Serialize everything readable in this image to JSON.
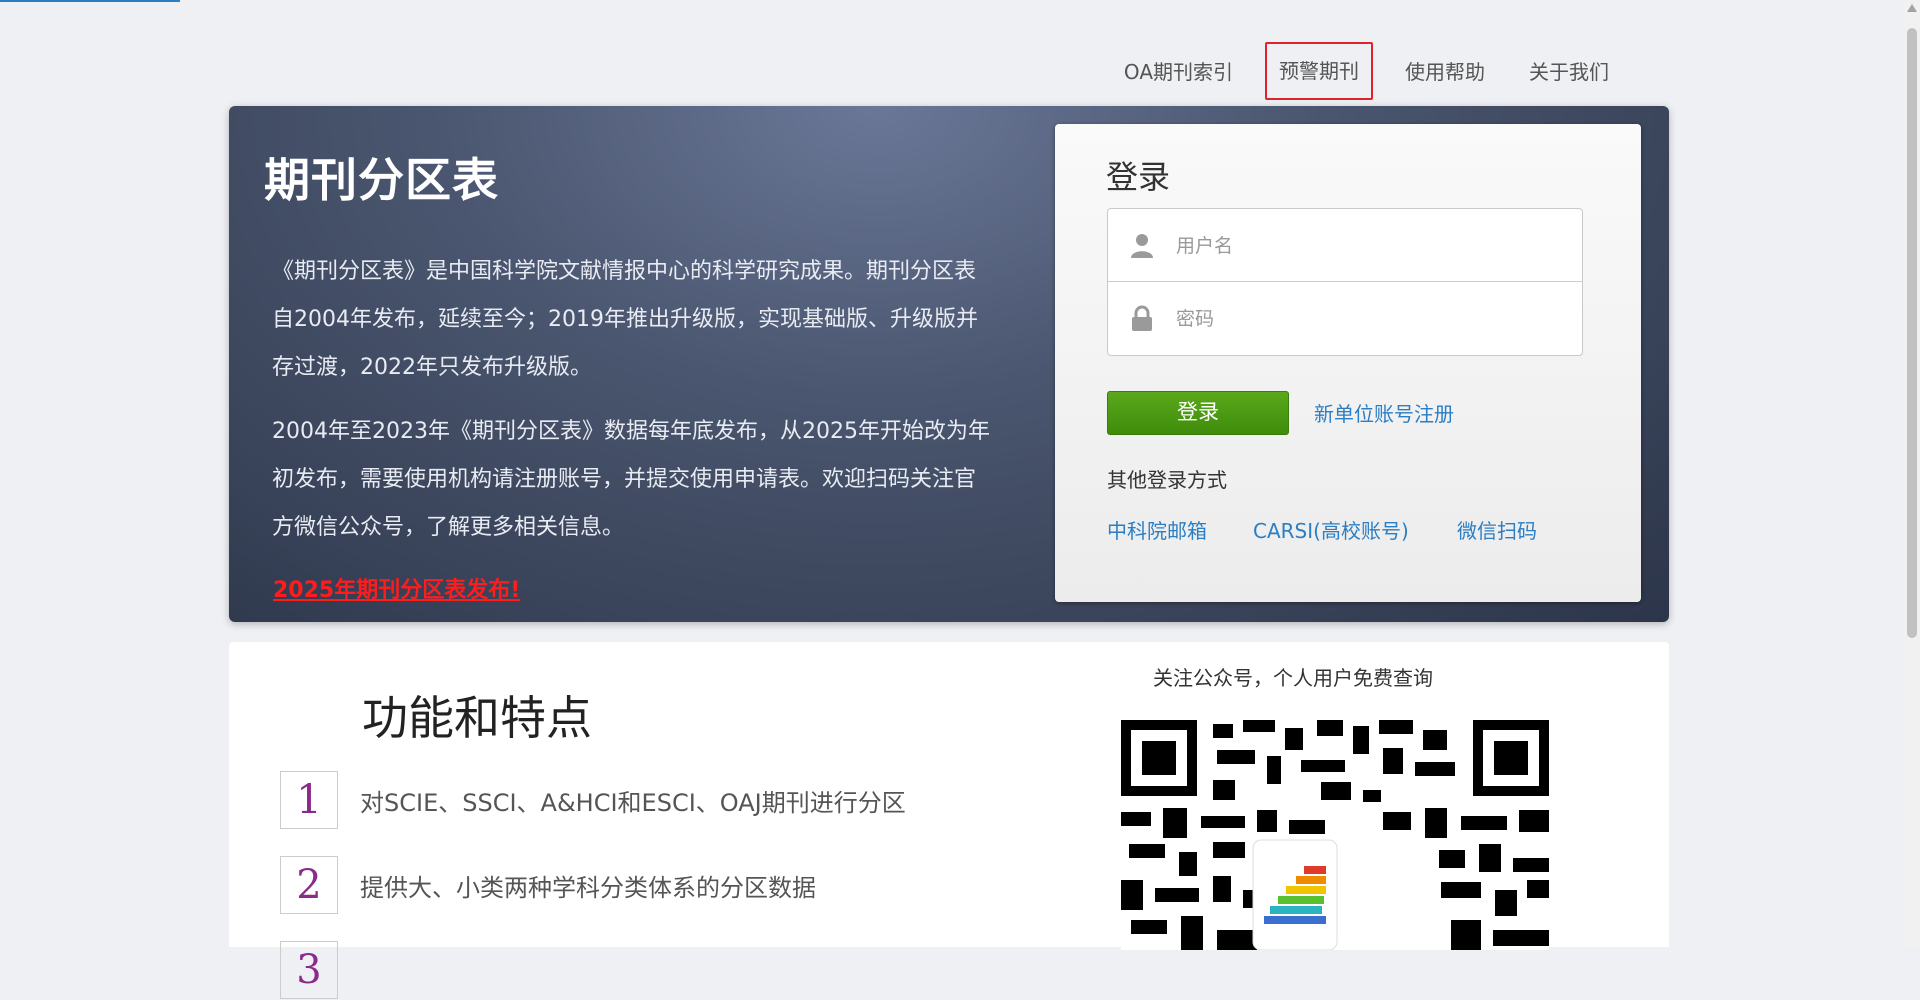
{
  "nav": [
    "OA期刊索引",
    "预警期刊",
    "使用帮助",
    "关于我们"
  ],
  "hero": {
    "title": "期刊分区表",
    "p1": "《期刊分区表》是中国科学院文献情报中心的科学研究成果。期刊分区表自2004年发布，延续至今；2019年推出升级版，实现基础版、升级版并存过渡，2022年只发布升级版。",
    "p2": "2004年至2023年《期刊分区表》数据每年底发布，从2025年开始改为年初发布，需要使用机构请注册账号，并提交使用申请表。欢迎扫码关注官方微信公众号，了解更多相关信息。",
    "news": "2025年期刊分区表发布!"
  },
  "login": {
    "title": "登录",
    "username_placeholder": "用户名",
    "password_placeholder": "密码",
    "button": "登录",
    "register": "新单位账号注册",
    "other_label": "其他登录方式",
    "alt": [
      "中科院邮箱",
      "CARSI(高校账号)",
      "微信扫码"
    ]
  },
  "features": {
    "title": "功能和特点",
    "items": [
      {
        "num": "1",
        "text": "对SCIE、SSCI、A&HCI和ESCI、OAJ期刊进行分区"
      },
      {
        "num": "2",
        "text": "提供大、小类两种学科分类体系的分区数据"
      },
      {
        "num": "3",
        "text": ""
      }
    ]
  },
  "qr": {
    "caption": "关注公众号，个人用户免费查询"
  },
  "colors": {
    "accent_green": "#4a9a12",
    "link_blue": "#2b7ec4",
    "news_red": "#ff1c1c",
    "highlight_box": "#e0232b"
  }
}
